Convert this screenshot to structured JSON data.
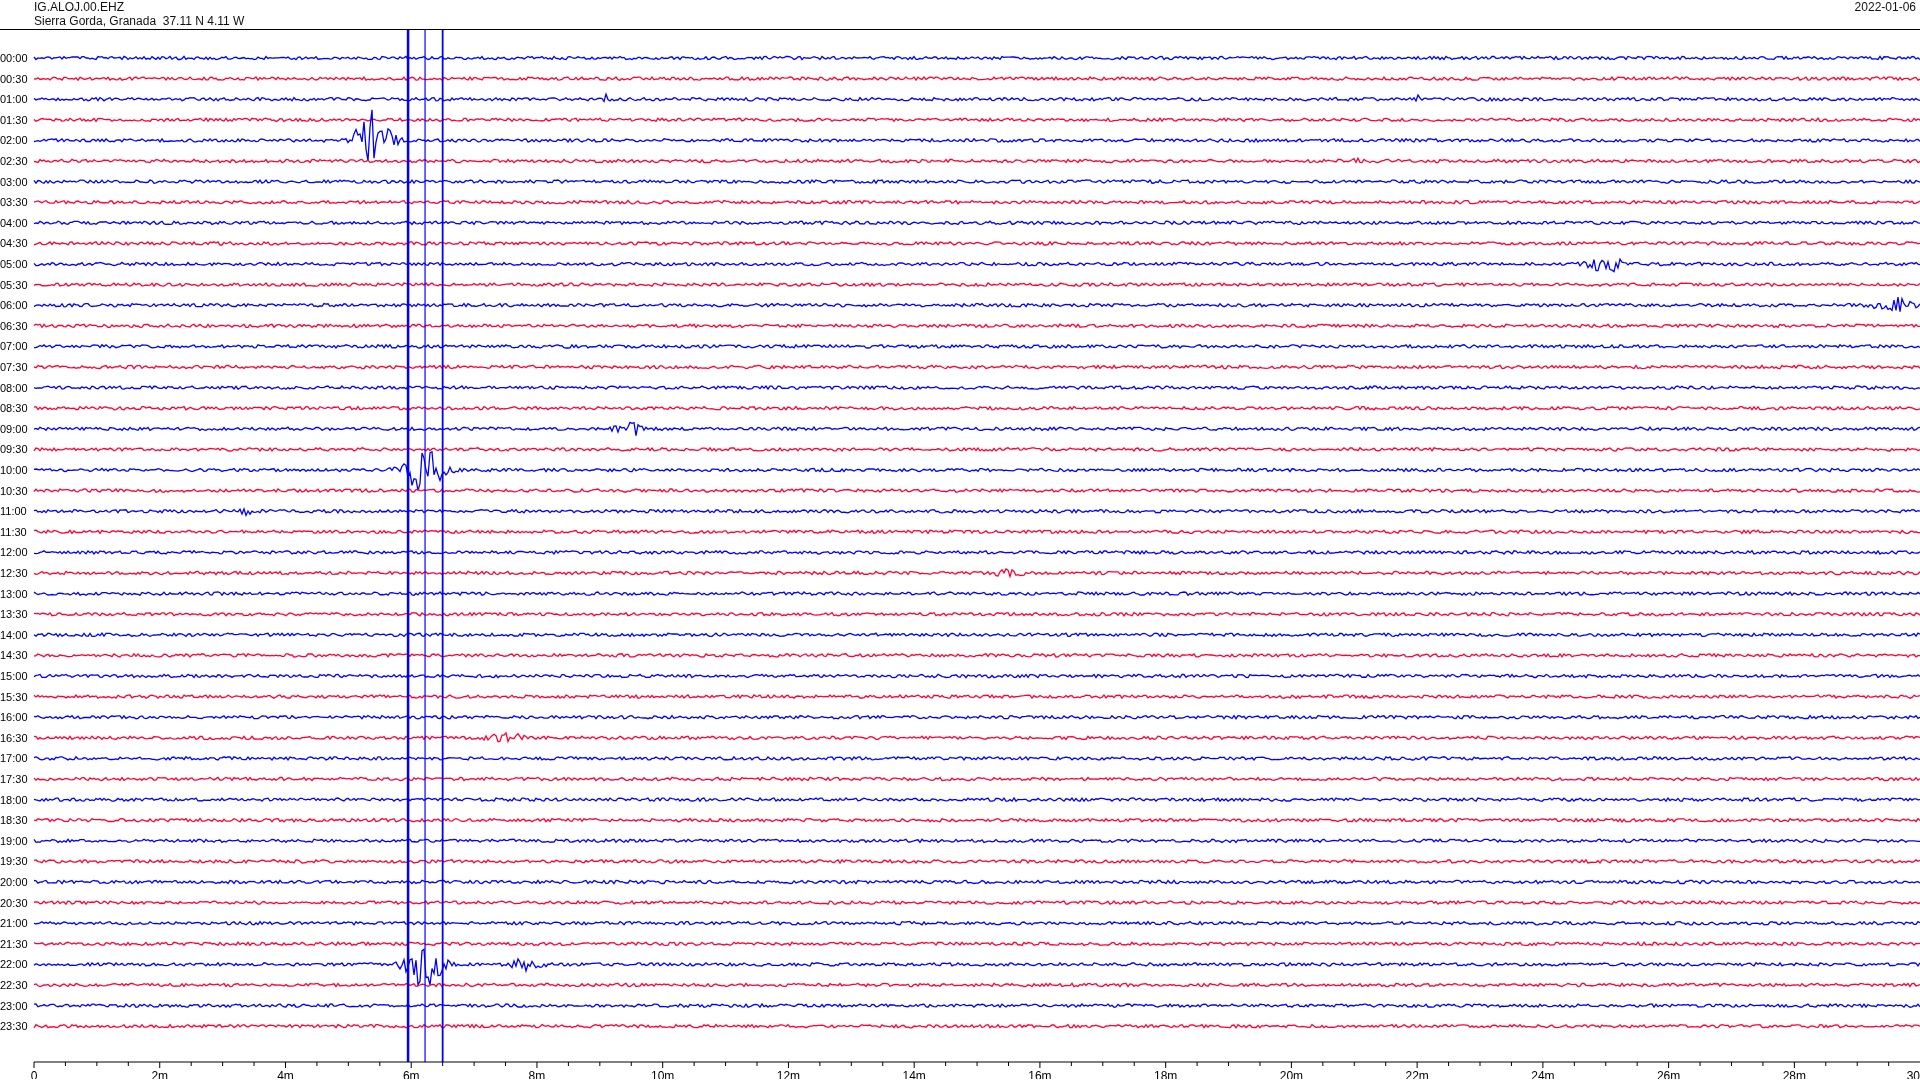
{
  "header": {
    "station": "IG.ALOJ.00.EHZ",
    "location": "Sierra Gorda, Granada  37.11 N 4.11 W",
    "date": "2022-01-06"
  },
  "traces": [
    {
      "label": "00:00",
      "color": "#0000ff"
    },
    {
      "label": "00:30",
      "color": "#ff0033"
    },
    {
      "label": "01:00",
      "color": "#0000ff"
    },
    {
      "label": "01:30",
      "color": "#ff0033"
    },
    {
      "label": "02:00",
      "color": "#0000ff"
    },
    {
      "label": "02:30",
      "color": "#ff0033"
    },
    {
      "label": "03:00",
      "color": "#0000ff"
    },
    {
      "label": "03:30",
      "color": "#ff0033"
    },
    {
      "label": "04:00",
      "color": "#0000ff"
    },
    {
      "label": "04:30",
      "color": "#ff0033"
    },
    {
      "label": "05:00",
      "color": "#0000ff"
    },
    {
      "label": "05:30",
      "color": "#ff0033"
    },
    {
      "label": "06:00",
      "color": "#0000ff"
    },
    {
      "label": "06:30",
      "color": "#ff0033"
    },
    {
      "label": "07:00",
      "color": "#0000ff"
    },
    {
      "label": "07:30",
      "color": "#ff0033"
    },
    {
      "label": "08:00",
      "color": "#0000ff"
    },
    {
      "label": "08:30",
      "color": "#ff0033"
    },
    {
      "label": "09:00",
      "color": "#0000ff"
    },
    {
      "label": "09:30",
      "color": "#ff0033"
    },
    {
      "label": "10:00",
      "color": "#0000ff"
    },
    {
      "label": "10:30",
      "color": "#ff0033"
    },
    {
      "label": "11:00",
      "color": "#0000ff"
    },
    {
      "label": "11:30",
      "color": "#ff0033"
    },
    {
      "label": "12:00",
      "color": "#0000ff"
    },
    {
      "label": "12:30",
      "color": "#ff0033"
    },
    {
      "label": "13:00",
      "color": "#0000ff"
    },
    {
      "label": "13:30",
      "color": "#ff0033"
    },
    {
      "label": "14:00",
      "color": "#0000ff"
    },
    {
      "label": "14:30",
      "color": "#ff0033"
    },
    {
      "label": "15:00",
      "color": "#0000ff"
    },
    {
      "label": "15:30",
      "color": "#ff0033"
    },
    {
      "label": "16:00",
      "color": "#0000ff"
    },
    {
      "label": "16:30",
      "color": "#ff0033"
    },
    {
      "label": "17:00",
      "color": "#0000ff"
    },
    {
      "label": "17:30",
      "color": "#ff0033"
    },
    {
      "label": "18:00",
      "color": "#0000ff"
    },
    {
      "label": "18:30",
      "color": "#ff0033"
    },
    {
      "label": "19:00",
      "color": "#0000ff"
    },
    {
      "label": "19:30",
      "color": "#ff0033"
    },
    {
      "label": "20:00",
      "color": "#0000ff"
    },
    {
      "label": "20:30",
      "color": "#ff0033"
    },
    {
      "label": "21:00",
      "color": "#0000ff"
    },
    {
      "label": "21:30",
      "color": "#ff0033"
    },
    {
      "label": "22:00",
      "color": "#0000ff"
    },
    {
      "label": "22:30",
      "color": "#ff0033"
    },
    {
      "label": "23:00",
      "color": "#0000ff"
    },
    {
      "label": "23:30",
      "color": "#ff0033"
    }
  ],
  "axis": {
    "labels": [
      "0",
      "2m",
      "4m",
      "6m",
      "8m",
      "10m",
      "12m",
      "14m",
      "16m",
      "18m",
      "20m",
      "22m",
      "24m",
      "26m",
      "28m",
      "30"
    ]
  }
}
